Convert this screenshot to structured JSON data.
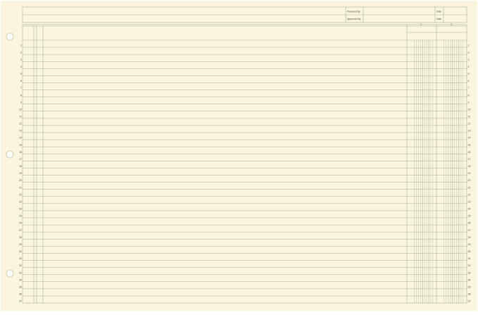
{
  "header": {
    "prepared_by_label": "Prepared By",
    "approved_by_label": "Approved By",
    "date_label_1": "Date",
    "date_label_2": "Date"
  },
  "column_groups": [
    "1",
    "2"
  ],
  "row_numbers": [
    "1",
    "2",
    "3",
    "4",
    "5",
    "6",
    "7",
    "8",
    "9",
    "10",
    "11",
    "12",
    "13",
    "14",
    "15",
    "16",
    "17",
    "18",
    "19",
    "20",
    "21",
    "22",
    "23",
    "24",
    "25",
    "26",
    "27",
    "28",
    "29",
    "30",
    "31",
    "32",
    "33",
    "34",
    "35",
    "36",
    "37"
  ],
  "colors": {
    "paper": "#FAF6DD",
    "rule": "#A8B09C",
    "text": "#4A4A40"
  }
}
